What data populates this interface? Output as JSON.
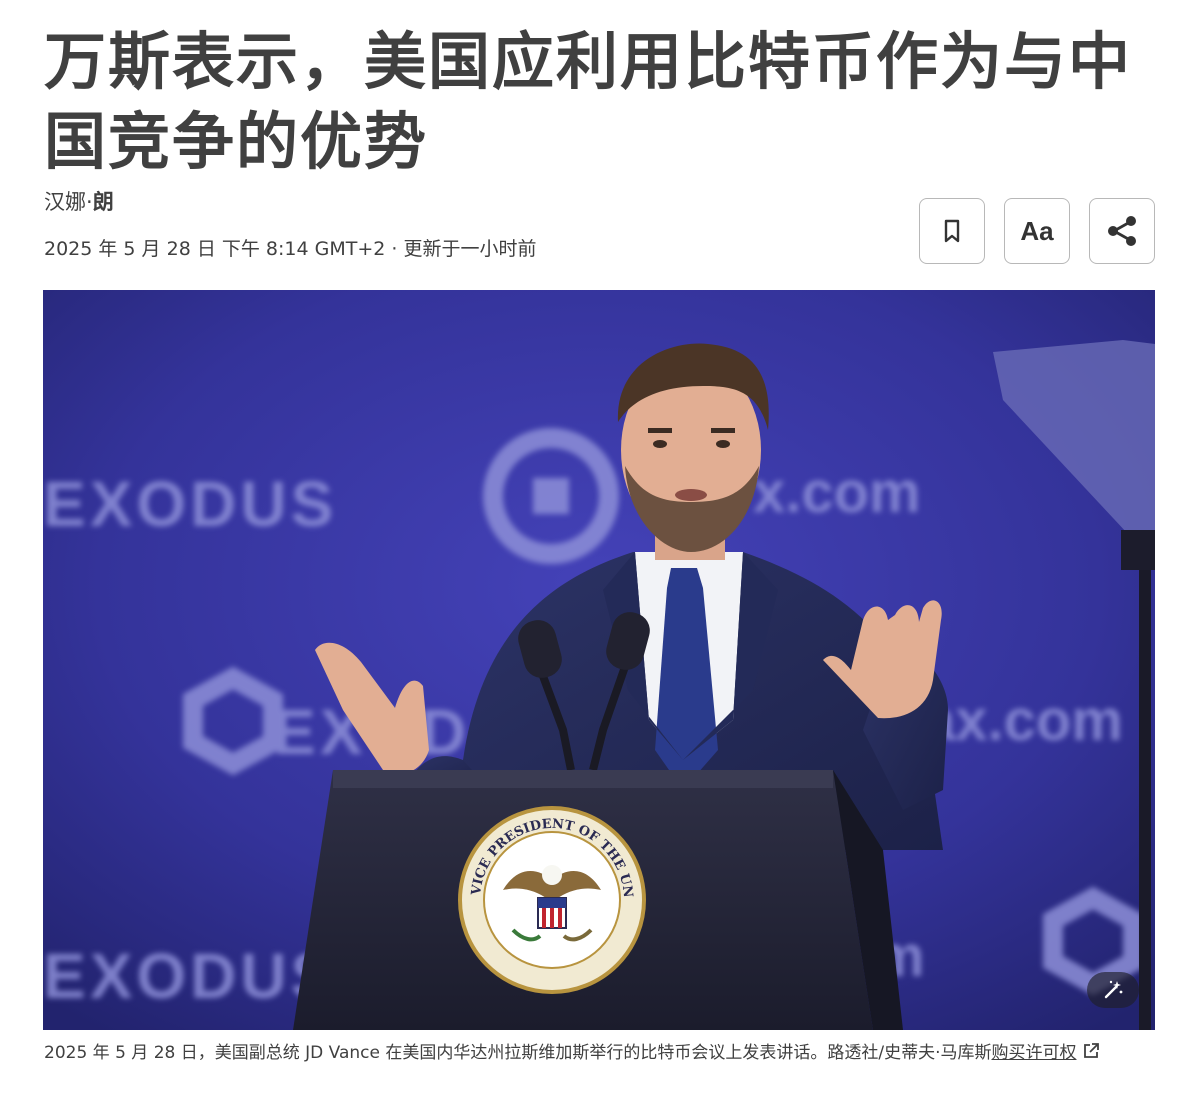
{
  "article": {
    "headline": "万斯表示，美国应利用比特币作为与中国竞争的优势",
    "author_prefix": "汉娜·",
    "author_link": "朗",
    "dateline": "2025 年 5 月 28 日 下午 8:14 GMT+2 · 更新于一小时前"
  },
  "toolbar": {
    "bookmark_icon": "bookmark-icon",
    "text_size_label": "Aa",
    "share_icon": "share-icon"
  },
  "photo": {
    "backdrop_text_1": "EXODUS",
    "backdrop_text_2": "x.com",
    "backdrop_text_3": "EXOD",
    "backdrop_text_4": "ax.com",
    "backdrop_text_5": "EXODUS",
    "backdrop_text_6": "m",
    "seal_text": "VICE PRESIDENT OF THE UNITED STATES",
    "magic_icon": "magic-wand-icon"
  },
  "caption": {
    "text": "2025 年 5 月 28 日，美国副总统 JD Vance 在美国内华达州拉斯维加斯举行的比特币会议上发表讲话。路透社/史蒂夫·马库斯",
    "license_link": "购买许可权",
    "external_icon": "external-link-icon"
  }
}
